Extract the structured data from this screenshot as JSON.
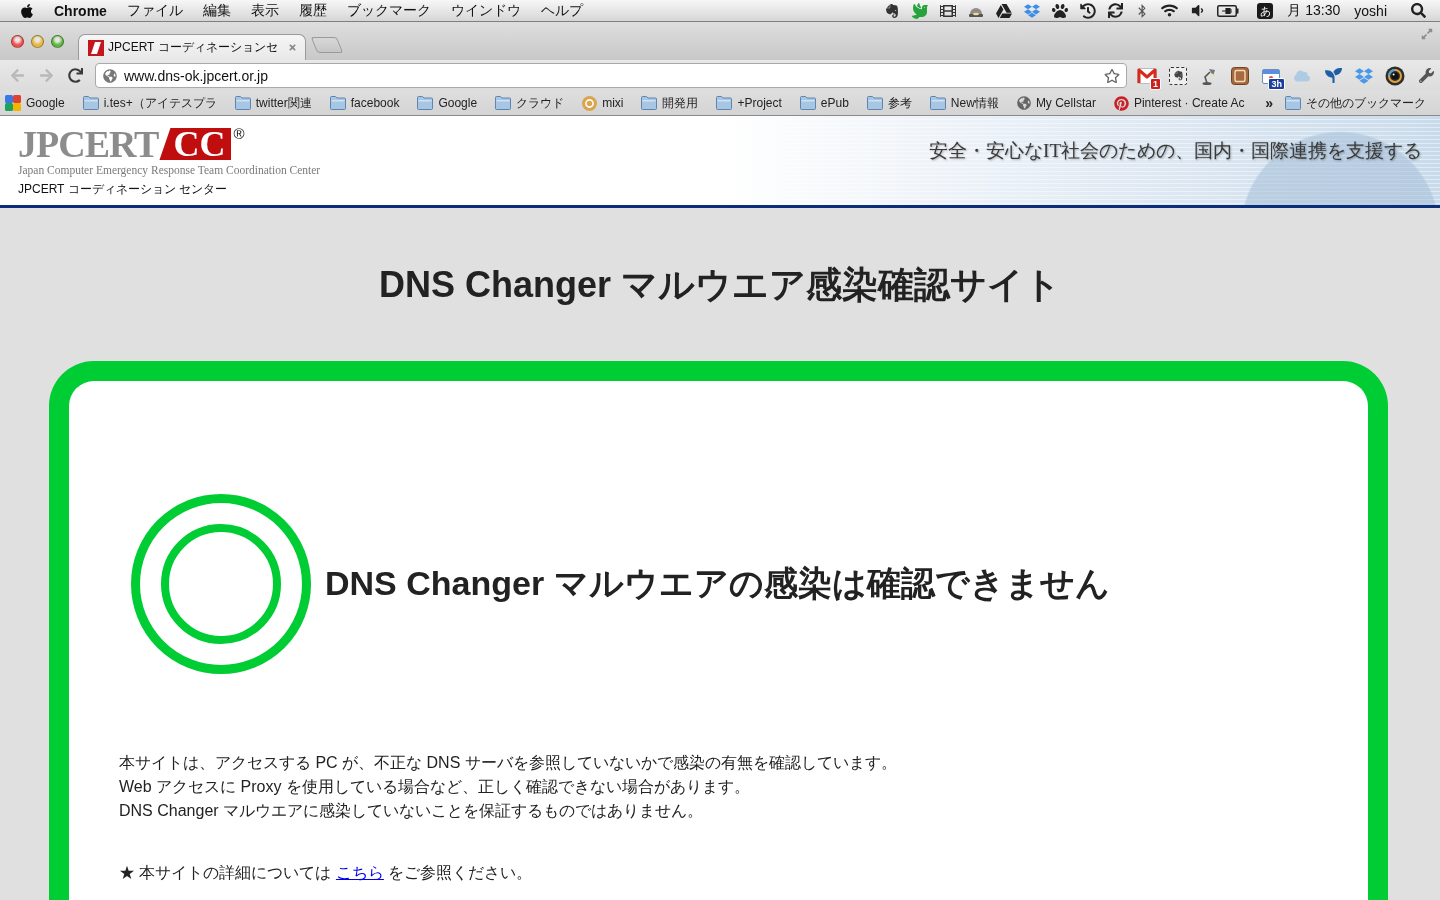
{
  "menu_bar": {
    "app_name": "Chrome",
    "menus": [
      "ファイル",
      "編集",
      "表示",
      "履歴",
      "ブックマーク",
      "ウインドウ",
      "ヘルプ"
    ],
    "input_mode": "あ",
    "clock": "月 13:30",
    "user": "yoshi"
  },
  "browser": {
    "tabs": [
      {
        "title": "JPCERT コーディネーションセ",
        "selected": true
      }
    ],
    "toolbar": {
      "nav_buttons": [
        {
          "kind": "back",
          "disabled": true
        },
        {
          "kind": "forward",
          "disabled": true
        },
        {
          "kind": "reload",
          "disabled": false
        }
      ],
      "url": "www.dns-ok.jpcert.or.jp",
      "mail_badge": "1",
      "calendar_badge": "3h"
    },
    "bookmarks_bar": {
      "items": [
        {
          "kind": "tiles",
          "label": "Google"
        },
        {
          "kind": "folder",
          "label": "i.tes+（アイテスプラ"
        },
        {
          "kind": "folder",
          "label": "twitter関連"
        },
        {
          "kind": "folder",
          "label": "facebook"
        },
        {
          "kind": "folder",
          "label": "Google"
        },
        {
          "kind": "folder",
          "label": "クラウド"
        },
        {
          "kind": "disc",
          "label": "mixi"
        },
        {
          "kind": "folder",
          "label": "開発用"
        },
        {
          "kind": "folder",
          "label": "+Project"
        },
        {
          "kind": "folder",
          "label": "ePub"
        },
        {
          "kind": "folder",
          "label": "参考"
        },
        {
          "kind": "folder",
          "label": "New情報"
        },
        {
          "kind": "globe",
          "label": "My Cellstar"
        },
        {
          "kind": "pin",
          "label": "Pinterest · Create Ac"
        }
      ],
      "overflow": "»",
      "other": {
        "kind": "folder",
        "label": "その他のブックマーク"
      }
    }
  },
  "site_header": {
    "logo": {
      "wordmark": "JPCERT",
      "badge": "CC",
      "registered": "®"
    },
    "org_name_en": "Japan Computer Emergency Response Team Coordination Center",
    "org_name_ja": "JPCERT コーディネーション センター",
    "tagline": "安全・安心なIT社会のための、国内・国際連携を支援する"
  },
  "page": {
    "title": "DNS Changer マルウエア感染確認サイト",
    "result": {
      "kind": "ok",
      "message": "DNS Changer マルウエアの感染は確認できません"
    },
    "notes": [
      "本サイトは、アクセスする PC が、不正な DNS サーバを参照していないかで感染の有無を確認しています。",
      "Web アクセスに Proxy を使用している場合など、正しく確認できない場合があります。",
      "DNS Changer マルウエアに感染していないことを保証するものではありません。"
    ],
    "details": {
      "marker": "★",
      "before": "本サイトの詳細については",
      "link": "こちら",
      "after": "をご参照ください。"
    }
  }
}
